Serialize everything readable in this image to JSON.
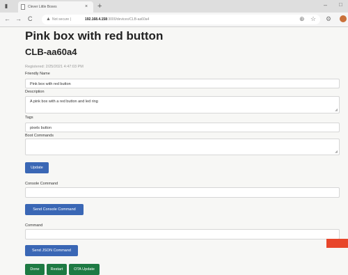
{
  "browser": {
    "tab_title": "Clever Little Boxes",
    "tab_close": "×",
    "new_tab": "+",
    "back": "←",
    "forward": "→",
    "reload": "C",
    "warning": "▲",
    "not_secure": "Not secure",
    "separator": "|",
    "url_host": "192.168.4.158",
    "url_path": ":3000/devices/CLB-aa60a4",
    "minimize": "–",
    "maximize": "□"
  },
  "page": {
    "title": "Pink box with red button",
    "device_id": "CLB-aa60a4",
    "registered": "Registered: 2/25/2021 4:47:03 PM",
    "friendly_name": {
      "label": "Friendly Name",
      "value": "Pink box with red button"
    },
    "description": {
      "label": "Description",
      "value": "A pink box with a red button and led ring"
    },
    "tags": {
      "label": "Tags",
      "value": "pixels button"
    },
    "boot_commands": {
      "label": "Boot Commands",
      "value": ""
    },
    "update_button": "Update",
    "console_command": {
      "label": "Console Command",
      "value": ""
    },
    "send_console_button": "Send Console Command",
    "command": {
      "label": "Command",
      "value": ""
    },
    "send_json_button": "Send JSON Command",
    "done_button": "Done",
    "restart_button": "Restart",
    "ota_button": "OTA Update"
  },
  "icons": [
    "menu-icon",
    "page-icon",
    "close-icon",
    "plus-icon",
    "back-arrow-icon",
    "forward-arrow-icon",
    "reload-icon",
    "warning-icon",
    "translate-icon",
    "star-icon",
    "extension-icon",
    "profile-avatar"
  ],
  "colors": {
    "primary_button": "#3a67b5",
    "success_button": "#1e7a43",
    "accent_tag": "#e8462b"
  }
}
